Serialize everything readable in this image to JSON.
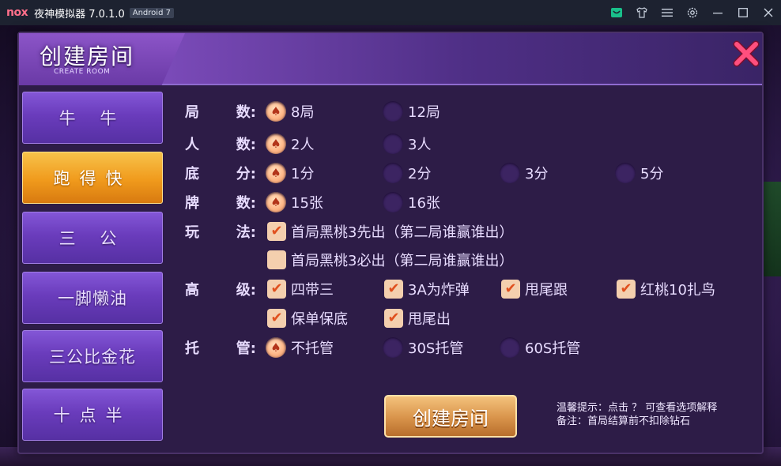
{
  "window": {
    "logo": "nox",
    "title": "夜神模拟器 7.0.1.0",
    "android_badge": "Android 7",
    "icons": [
      "store-icon",
      "shirt-icon",
      "menu-icon",
      "settings-icon",
      "minimize-icon",
      "maximize-icon",
      "close-icon"
    ]
  },
  "dialog": {
    "title": "创建房间",
    "subtitle": "CREATE ROOM"
  },
  "sidebar": {
    "items": [
      {
        "label": "牛 牛",
        "active": false
      },
      {
        "label": "跑得快",
        "active": true
      },
      {
        "label": "三 公",
        "active": false
      },
      {
        "label": "一脚懒油",
        "active": false
      },
      {
        "label": "三公比金花",
        "active": false
      },
      {
        "label": "十点半",
        "active": false
      }
    ]
  },
  "options": {
    "rounds": {
      "label_a": "局",
      "label_b": "数:",
      "choices": [
        "8局",
        "12局"
      ],
      "selected": 0
    },
    "players": {
      "label_a": "人",
      "label_b": "数:",
      "choices": [
        "2人",
        "3人"
      ],
      "selected": 0
    },
    "base": {
      "label_a": "底",
      "label_b": "分:",
      "choices": [
        "1分",
        "2分",
        "3分",
        "5分"
      ],
      "selected": 0
    },
    "cards": {
      "label_a": "牌",
      "label_b": "数:",
      "choices": [
        "15张",
        "16张"
      ],
      "selected": 0
    },
    "play": {
      "label_a": "玩",
      "label_b": "法:",
      "choices": [
        "首局黑桃3先出（第二局谁赢谁出）",
        "首局黑桃3必出（第二局谁赢谁出）"
      ],
      "checked": [
        true,
        false
      ]
    },
    "advanced": {
      "label_a": "高",
      "label_b": "级:",
      "choices": [
        "四带三",
        "3A为炸弹",
        "甩尾跟",
        "红桃10扎鸟",
        "保单保底",
        "甩尾出"
      ],
      "checked": [
        true,
        true,
        true,
        true,
        true,
        true
      ]
    },
    "auto": {
      "label_a": "托",
      "label_b": "管:",
      "choices": [
        "不托管",
        "30S托管",
        "60S托管"
      ],
      "selected": 0
    }
  },
  "create_button": "创建房间",
  "tips": {
    "line1": "温馨提示：点击 ？ 可查看选项解释",
    "line2": "备注：首局结算前不扣除钻石"
  },
  "colors": {
    "accent_gold": "#f09a1c",
    "dialog_bg": "#2d1c47",
    "sidebar_purple": "#6a3cbc"
  }
}
